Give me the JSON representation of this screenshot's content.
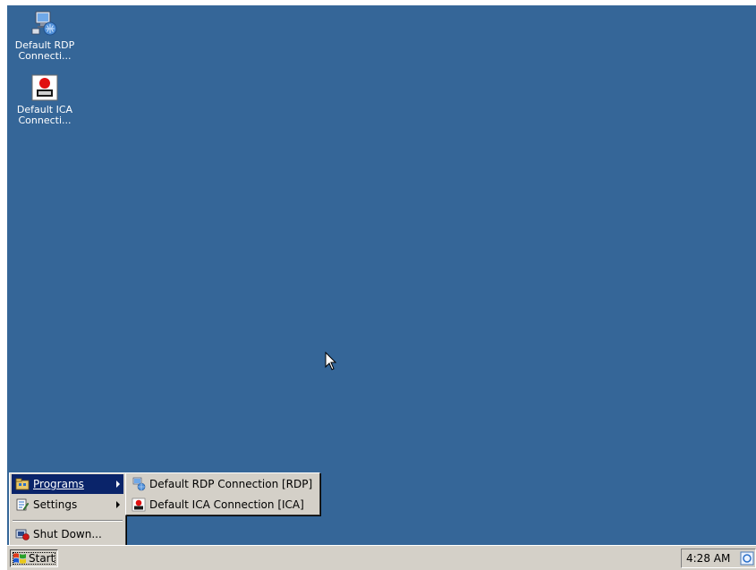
{
  "desktop": {
    "background": "#356698",
    "icons": [
      {
        "label_line1": "Default RDP",
        "label_line2": "Connecti...",
        "icon": "rdp-computer-icon"
      },
      {
        "label_line1": "Default ICA",
        "label_line2": "Connecti...",
        "icon": "ica-citrix-icon"
      }
    ]
  },
  "start_menu": {
    "items": [
      {
        "label": "Programs",
        "accel": "P",
        "icon": "programs-folder-icon",
        "has_submenu": true,
        "highlighted": true
      },
      {
        "label": "Settings",
        "accel": "S",
        "icon": "settings-icon",
        "has_submenu": true,
        "highlighted": false
      },
      {
        "label": "Shut Down...",
        "accel": "u",
        "icon": "shutdown-icon",
        "has_submenu": false,
        "highlighted": false
      }
    ]
  },
  "programs_menu": {
    "items": [
      {
        "label": "Default RDP Connection [RDP]",
        "icon": "rdp-computer-icon"
      },
      {
        "label": "Default ICA Connection [ICA]",
        "icon": "ica-citrix-icon"
      }
    ]
  },
  "taskbar": {
    "start_label": "Start",
    "clock": "4:28 AM",
    "tray_icon": "network-tray-icon"
  },
  "colors": {
    "desktop": "#356698",
    "menu_face": "#d4d0c8",
    "highlight": "#0a246a"
  }
}
